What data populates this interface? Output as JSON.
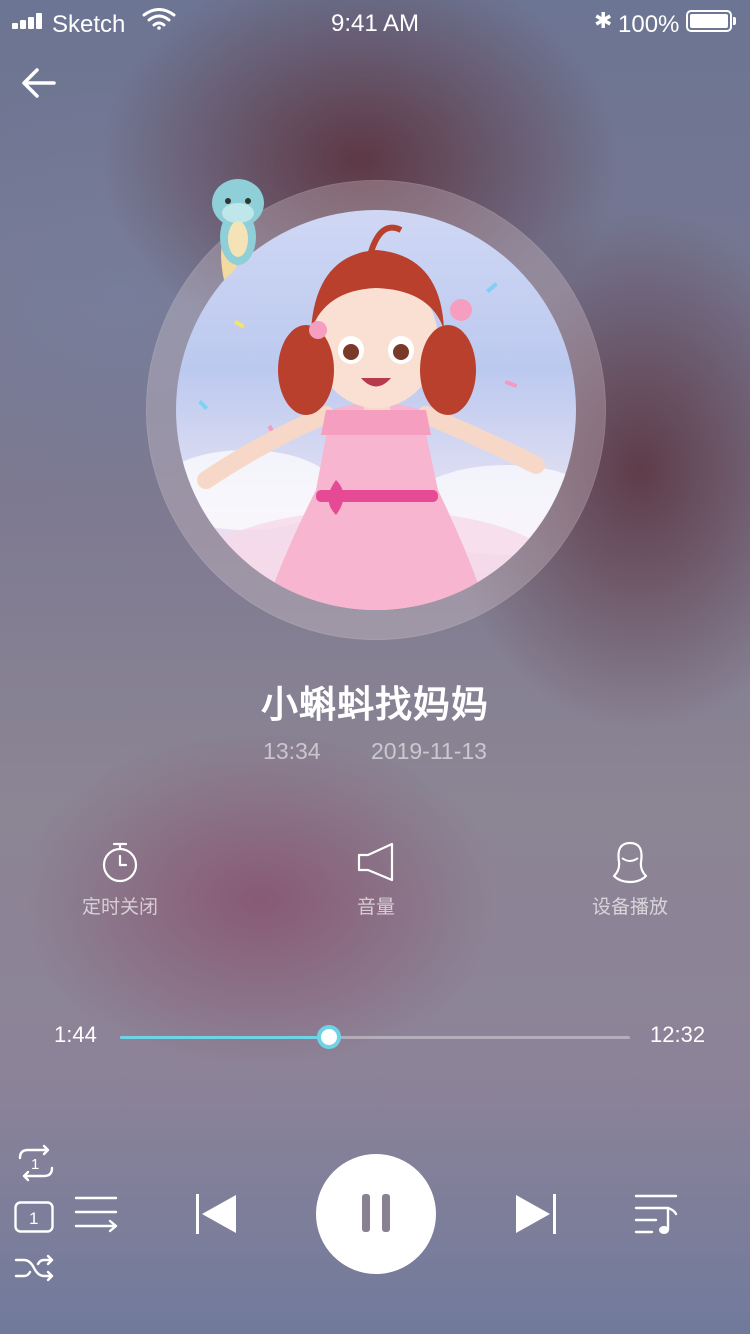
{
  "status_bar": {
    "carrier": "Sketch",
    "time": "9:41 AM",
    "battery": "100%"
  },
  "track": {
    "title": "小蝌蚪找妈妈",
    "duration": "13:34",
    "date": "2019-11-13"
  },
  "functions": {
    "timer_label": "定时关闭",
    "volume_label": "音量",
    "device_label": "设备播放"
  },
  "progress": {
    "current": "1:44",
    "total": "12:32",
    "fraction": 0.41
  },
  "colors": {
    "accent": "#6fd3e6"
  },
  "icons": [
    "back-arrow-icon",
    "timer-icon",
    "speaker-icon",
    "device-icon",
    "repeat-one-icon",
    "play-once-icon",
    "shuffle-icon",
    "list-icon",
    "previous-icon",
    "pause-icon",
    "next-icon",
    "playlist-icon"
  ]
}
